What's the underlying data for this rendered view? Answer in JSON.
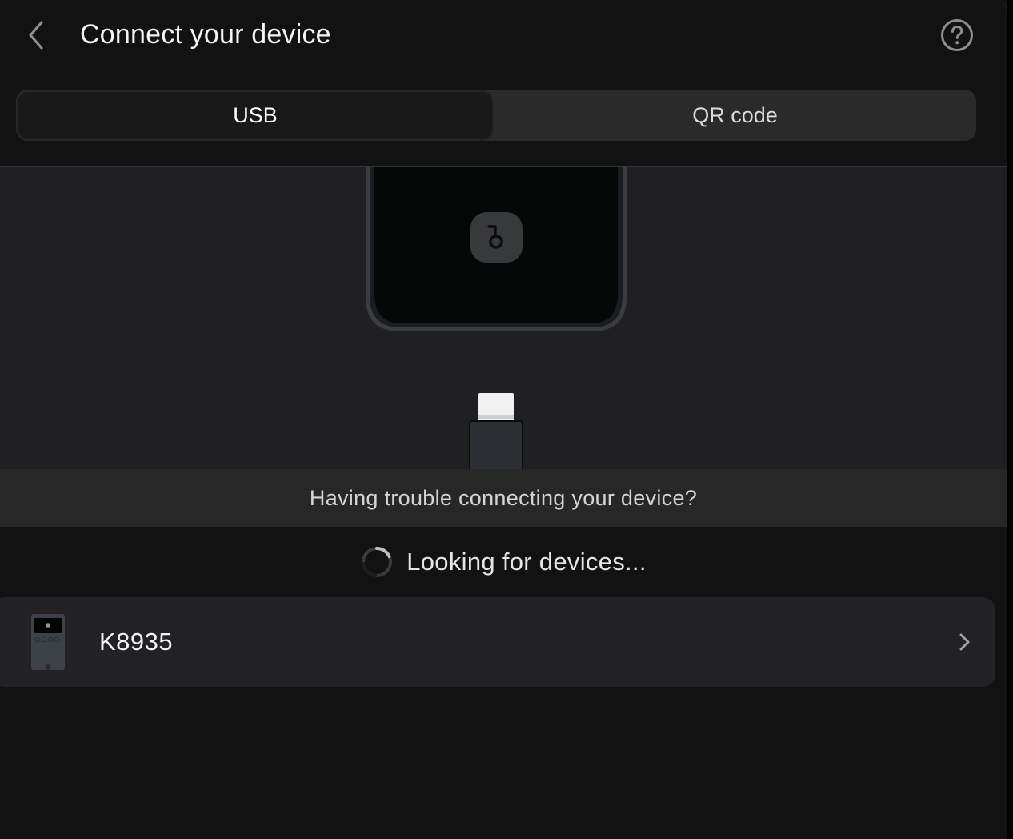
{
  "header": {
    "title": "Connect your device",
    "back_icon": "chevron-left-icon",
    "help_icon": "question-circle-icon"
  },
  "tabs": [
    {
      "label": "USB",
      "selected": true
    },
    {
      "label": "QR code",
      "selected": false
    }
  ],
  "illustration": {
    "device_icon": "phone-with-logo-icon",
    "connector_icon": "usb-c-connector-icon"
  },
  "trouble_link": "Having trouble connecting your device?",
  "status": {
    "text": "Looking for devices...",
    "icon": "spinner-icon"
  },
  "devices": [
    {
      "name": "K8935",
      "thumb_icon": "hardware-wallet-icon",
      "chevron_icon": "chevron-right-icon"
    }
  ],
  "colors": {
    "background": "#121213",
    "tab_track": "#2a2a2b",
    "tab_selected": "#19191a",
    "illustration_bg": "#202022",
    "trouble_bg": "#272728",
    "row_bg": "#222224"
  }
}
